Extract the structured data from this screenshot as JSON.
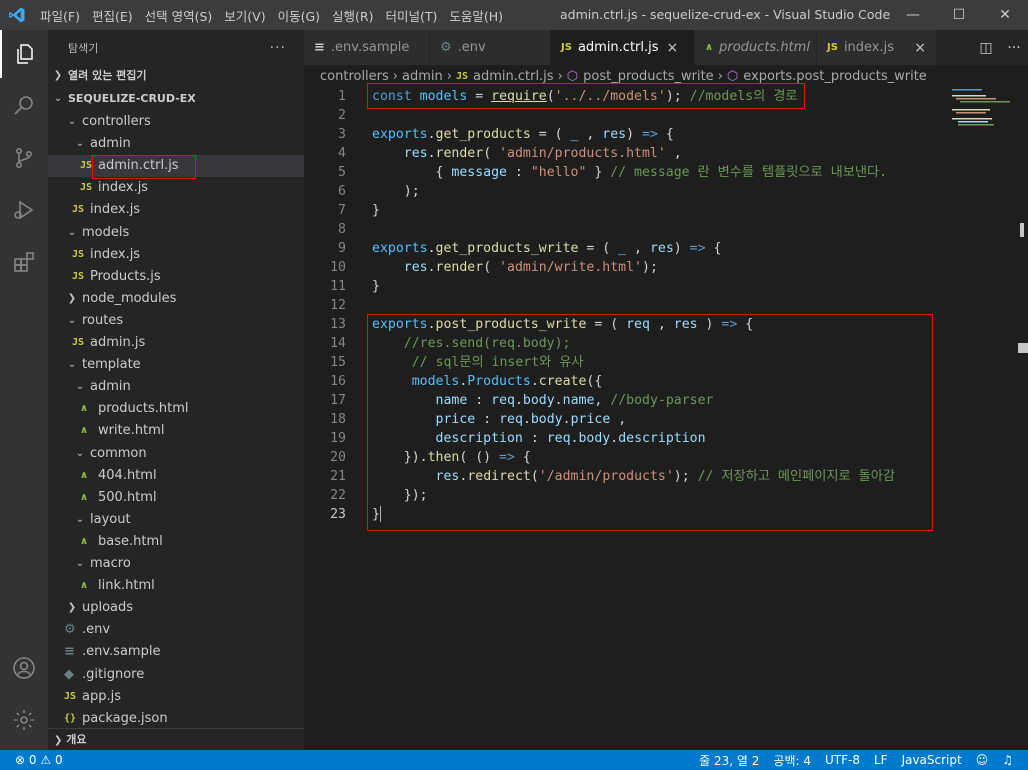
{
  "titlebar": {
    "menus": [
      "파일(F)",
      "편집(E)",
      "선택 영역(S)",
      "보기(V)",
      "이동(G)",
      "실행(R)",
      "터미널(T)",
      "도움말(H)"
    ],
    "window_title": "admin.ctrl.js - sequelize-crud-ex - Visual Studio Code"
  },
  "sidebar": {
    "title": "탐색기",
    "open_editors": "열려 있는 편집기",
    "project": "SEQUELIZE-CRUD-EX",
    "tree": [
      {
        "label": "controllers",
        "type": "folder",
        "open": true,
        "depth": 1
      },
      {
        "label": "admin",
        "type": "folder",
        "open": true,
        "depth": 2
      },
      {
        "label": "admin.ctrl.js",
        "type": "js",
        "depth": 3,
        "selected": true
      },
      {
        "label": "index.js",
        "type": "js",
        "depth": 3
      },
      {
        "label": "index.js",
        "type": "js",
        "depth": 2
      },
      {
        "label": "models",
        "type": "folder",
        "open": true,
        "depth": 1
      },
      {
        "label": "index.js",
        "type": "js",
        "depth": 2
      },
      {
        "label": "Products.js",
        "type": "js",
        "depth": 2
      },
      {
        "label": "node_modules",
        "type": "folder",
        "open": false,
        "depth": 1
      },
      {
        "label": "routes",
        "type": "folder",
        "open": true,
        "depth": 1
      },
      {
        "label": "admin.js",
        "type": "js",
        "depth": 2
      },
      {
        "label": "template",
        "type": "folder",
        "open": true,
        "depth": 1
      },
      {
        "label": "admin",
        "type": "folder",
        "open": true,
        "depth": 2
      },
      {
        "label": "products.html",
        "type": "html",
        "depth": 3
      },
      {
        "label": "write.html",
        "type": "html",
        "depth": 3
      },
      {
        "label": "common",
        "type": "folder",
        "open": true,
        "depth": 2
      },
      {
        "label": "404.html",
        "type": "html",
        "depth": 3
      },
      {
        "label": "500.html",
        "type": "html",
        "depth": 3
      },
      {
        "label": "layout",
        "type": "folder",
        "open": true,
        "depth": 2
      },
      {
        "label": "base.html",
        "type": "html",
        "depth": 3
      },
      {
        "label": "macro",
        "type": "folder",
        "open": true,
        "depth": 2
      },
      {
        "label": "link.html",
        "type": "html",
        "depth": 3
      },
      {
        "label": "uploads",
        "type": "folder",
        "open": false,
        "depth": 1
      },
      {
        "label": ".env",
        "type": "gear",
        "depth": 1
      },
      {
        "label": ".env.sample",
        "type": "none",
        "depth": 1
      },
      {
        "label": ".gitignore",
        "type": "dot",
        "depth": 1
      },
      {
        "label": "app.js",
        "type": "js",
        "depth": 1
      },
      {
        "label": "package.json",
        "type": "brace",
        "depth": 1
      }
    ],
    "outline": "개요"
  },
  "tabs": [
    {
      "label": ".env.sample",
      "icon": "≡",
      "active": false,
      "italic": false
    },
    {
      "label": ".env",
      "icon": "⚙",
      "active": false,
      "italic": false
    },
    {
      "label": "admin.ctrl.js",
      "icon": "JS",
      "active": true,
      "italic": false,
      "close": "×"
    },
    {
      "label": "products.html",
      "icon": "html",
      "active": false,
      "italic": true
    },
    {
      "label": "index.js",
      "icon": "JS",
      "active": false,
      "italic": false,
      "close": "×"
    }
  ],
  "breadcrumb": {
    "parts": [
      "controllers",
      "admin",
      "admin.ctrl.js",
      "post_products_write",
      "exports.post_products_write"
    ]
  },
  "editor": {
    "line_numbers": [
      "1",
      "2",
      "3",
      "4",
      "5",
      "6",
      "7",
      "8",
      "9",
      "10",
      "11",
      "12",
      "13",
      "14",
      "15",
      "16",
      "17",
      "18",
      "19",
      "20",
      "21",
      "22",
      "23"
    ],
    "current_line": 23,
    "comments": {
      "l1": "//models의 경로",
      "l5": "// message 란 변수를 템플릿으로 내보낸다.",
      "l14": "//res.send(req.body);",
      "l15": "// sql문의 insert와 유사",
      "l17": "//body-parser",
      "l21": "// 저장하고 메인페이지로 돌아감"
    },
    "strings": {
      "models_path": "'../../models'",
      "products_tpl": "'admin/products.html'",
      "hello": "\"hello\"",
      "write_tpl": "'admin/write.html'",
      "redirect": "'/admin/products'"
    }
  },
  "statusbar": {
    "errors": "0",
    "warnings": "0",
    "position": "줄 23, 열 2",
    "spaces": "공백: 4",
    "encoding": "UTF-8",
    "eol": "LF",
    "language": "JavaScript"
  },
  "colors": {
    "statusbar": "#007acc",
    "highlight_box": "#e51400"
  }
}
